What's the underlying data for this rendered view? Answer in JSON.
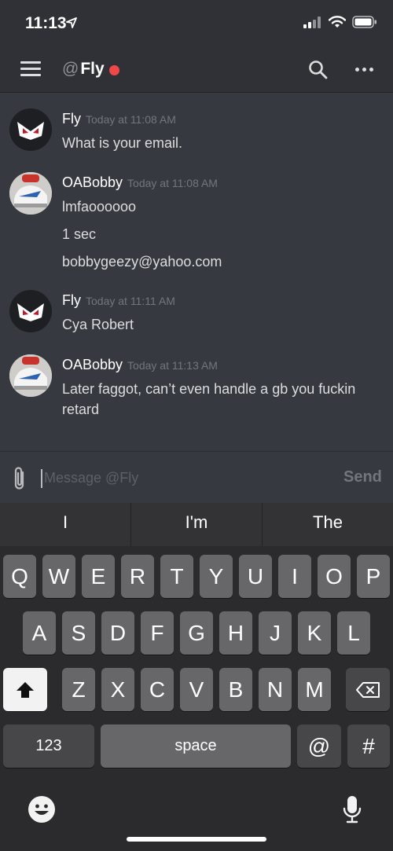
{
  "status_bar": {
    "time": "11:13"
  },
  "header": {
    "at_symbol": "@",
    "channel_name": "Fly",
    "status_color": "#f04747"
  },
  "messages": [
    {
      "author": "Fly",
      "timestamp": "Today at 11:08 AM",
      "lines": [
        "What is your email."
      ]
    },
    {
      "author": "OABobby",
      "timestamp": "Today at 11:08 AM",
      "lines": [
        "lmfaoooooo",
        "1 sec",
        "bobbygeezy@yahoo.com"
      ]
    },
    {
      "author": "Fly",
      "timestamp": "Today at 11:11 AM",
      "lines": [
        "Cya Robert"
      ]
    },
    {
      "author": "OABobby",
      "timestamp": "Today at 11:13 AM",
      "lines": [
        "Later faggot, can’t even handle a gb you fuckin retard"
      ]
    }
  ],
  "composer": {
    "placeholder": "Message @Fly",
    "send_label": "Send"
  },
  "keyboard": {
    "suggestions": [
      "I",
      "I'm",
      "The"
    ],
    "row1": [
      "Q",
      "W",
      "E",
      "R",
      "T",
      "Y",
      "U",
      "I",
      "O",
      "P"
    ],
    "row2": [
      "A",
      "S",
      "D",
      "F",
      "G",
      "H",
      "J",
      "K",
      "L"
    ],
    "row3": [
      "Z",
      "X",
      "C",
      "V",
      "B",
      "N",
      "M"
    ],
    "numbers_label": "123",
    "space_label": "space",
    "at_label": "@",
    "hash_label": "#"
  },
  "colors": {
    "background": "#36393f",
    "header": "#2f3136",
    "dnd": "#f04747"
  }
}
